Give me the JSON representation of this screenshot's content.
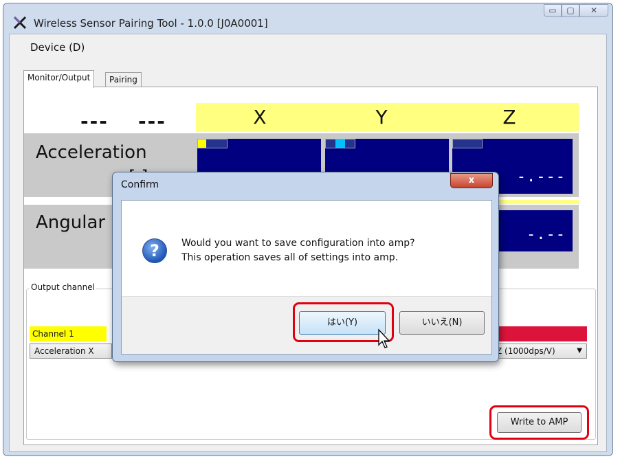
{
  "window": {
    "title": "Wireless Sensor Pairing Tool - 1.0.0 [J0A0001]",
    "caption_min": "▭",
    "caption_max": "▢",
    "caption_close": "✕"
  },
  "menu": {
    "device": "Device (D)"
  },
  "tabs": [
    {
      "label": "Monitor/Output",
      "active": true
    },
    {
      "label": "Pairing",
      "active": false
    }
  ],
  "monitor": {
    "placeholders": [
      "---",
      "---"
    ],
    "axes": [
      "X",
      "Y",
      "Z"
    ],
    "rows": [
      {
        "label": "Acceleration",
        "unit": "[ ]",
        "values": [
          "-.---",
          "-.---",
          "-.---"
        ]
      },
      {
        "label": "Angular",
        "values": [
          "-.---",
          "-.---",
          "-.--"
        ]
      }
    ]
  },
  "output": {
    "group_title": "Output channel",
    "channel1_label": "Channel 1",
    "channel1_select": "Acceleration X",
    "last_select": "Z (1000dps/V)",
    "write_button": "Write to AMP"
  },
  "dialog": {
    "title": "Confirm",
    "close_glyph": "x",
    "icon_glyph": "?",
    "message_line1": "Would you want to save configuration into amp?",
    "message_line2": "This operation saves all of settings into amp.",
    "yes_button": "はい(Y)",
    "no_button": "いいえ(N)"
  },
  "colors": {
    "axis_header": "#ffff80",
    "value_box": "#000080",
    "channel1": "#ffff00",
    "channel_red": "#dc143c",
    "highlight": "#e0000f"
  }
}
